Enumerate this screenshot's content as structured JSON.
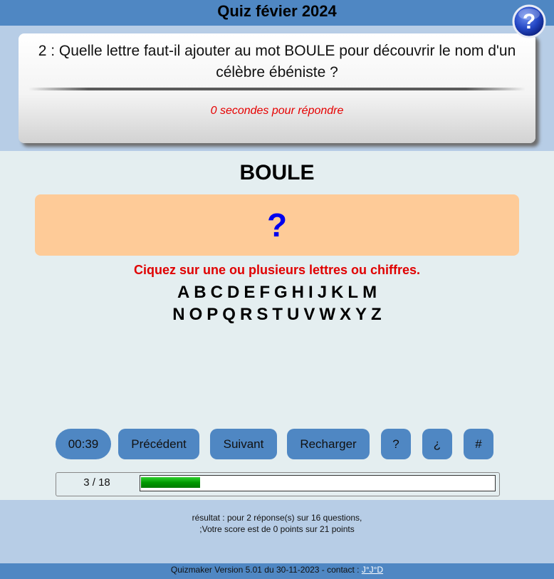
{
  "header": {
    "title": "Quiz févier 2024"
  },
  "question": {
    "text": "2 : Quelle lettre faut-il ajouter au mot BOULE pour découvrir le nom d'un célèbre ébéniste ?",
    "timer_text": "0 secondes pour répondre"
  },
  "puzzle": {
    "word": "BOULE",
    "answer_placeholder": "?",
    "instruction": "Ciquez sur une ou plusieurs lettres ou chiffres."
  },
  "letters": {
    "row1": [
      "A",
      "B",
      "C",
      "D",
      "E",
      "F",
      "G",
      "H",
      "I",
      "J",
      "K",
      "L",
      "M"
    ],
    "row2": [
      "N",
      "O",
      "P",
      "Q",
      "R",
      "S",
      "T",
      "U",
      "V",
      "W",
      "X",
      "Y",
      "Z"
    ]
  },
  "controls": {
    "clock": "00:39",
    "previous_label": "Précédent",
    "next_label": "Suivant",
    "reload_label": "Recharger",
    "question_label": "?",
    "inverted_question_label": "¿",
    "hash_label": "#"
  },
  "progress": {
    "label": "3 / 18",
    "current": 3,
    "total": 18
  },
  "result": {
    "line1": "résultat : pour 2 réponse(s) sur 16 questions,",
    "line2": ";Votre score est de 0 points sur 21 points"
  },
  "footer": {
    "text": "Quizmaker Version 5.01 du 30-11-2023 - contact : ",
    "contact_link": "J°J°D"
  },
  "colors": {
    "header_blue": "#4f87c3",
    "band_blue": "#b7cde6",
    "answer_bg": "#fecb98",
    "alert_red": "#e00000",
    "progress_green": "#009900"
  }
}
